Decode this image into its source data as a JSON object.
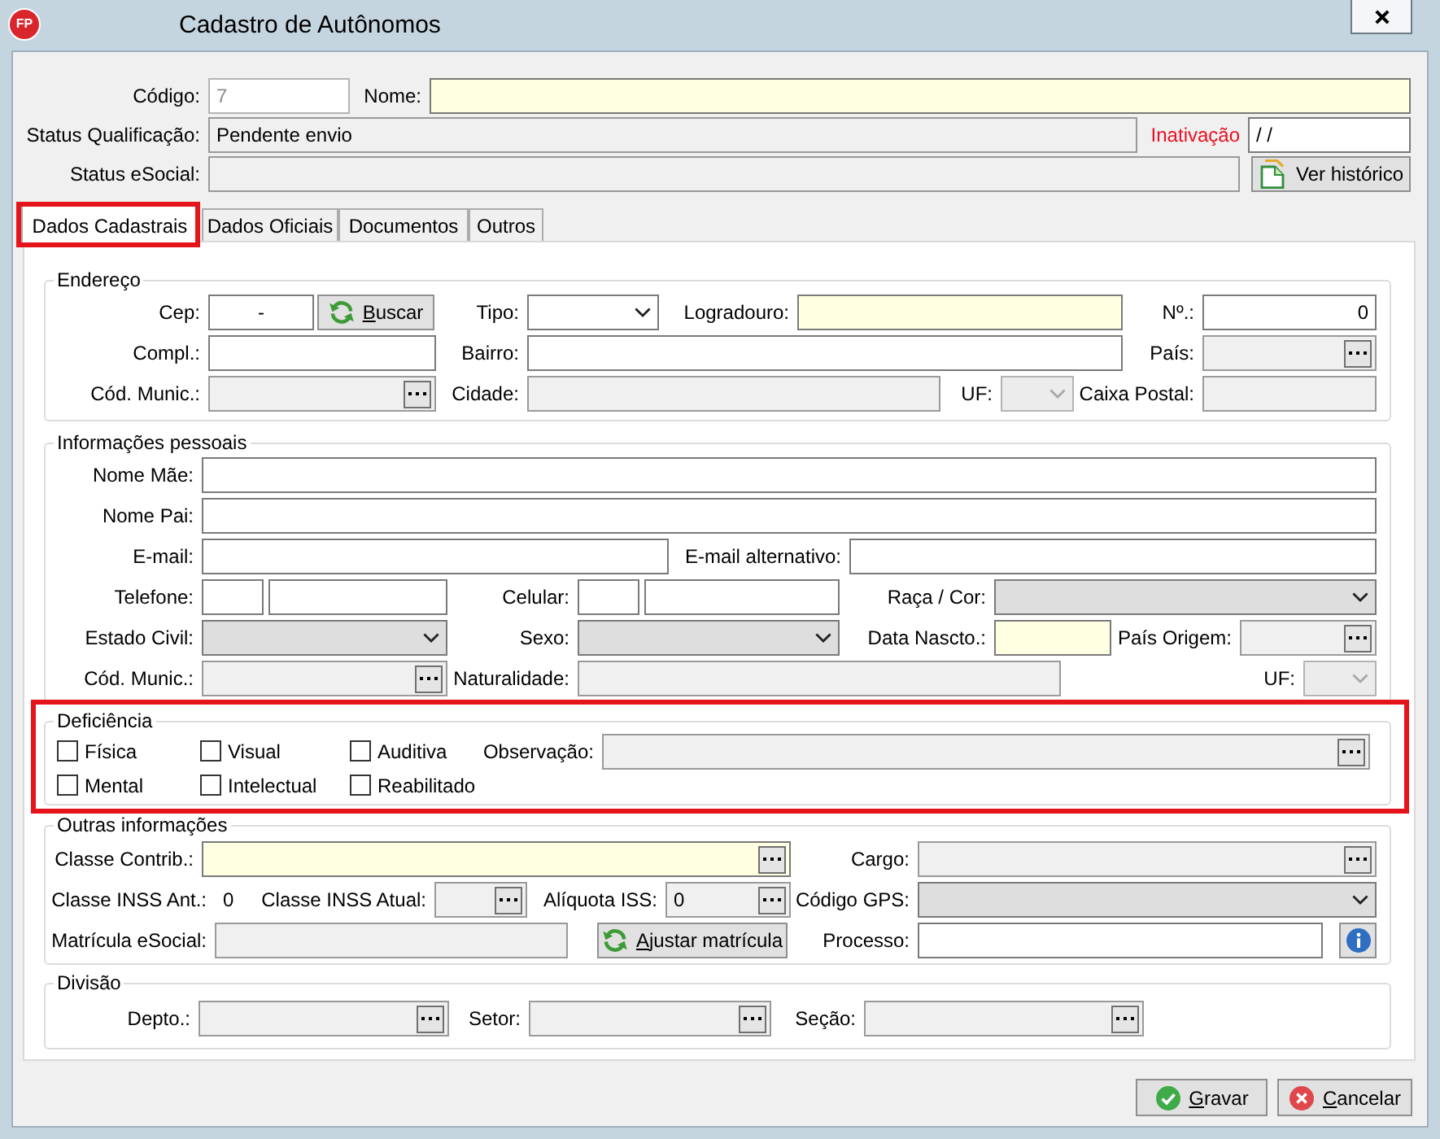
{
  "window": {
    "logo": "FP",
    "title": "Cadastro de Autônomos"
  },
  "header": [
    {
      "fields": [
        {
          "label": "Código:",
          "kind": "text",
          "value": "7",
          "required": false,
          "readonly": false,
          "disabled": true
        },
        {
          "label": "Nome:",
          "kind": "text",
          "required": true,
          "readonly": false,
          "disabled": false
        }
      ]
    },
    {
      "fields": [
        {
          "label": "Status Qualificação:",
          "kind": "text",
          "value": "Pendente envio",
          "required": false,
          "readonly": true,
          "disabled": false
        },
        {
          "label": "Inativação",
          "color": "#e81123",
          "kind": "text",
          "value": "/ /",
          "required": false,
          "readonly": false,
          "disabled": false
        }
      ]
    },
    {
      "fields": [
        {
          "label": "Status eSocial:",
          "kind": "text",
          "required": false,
          "readonly": true,
          "disabled": false
        },
        {
          "kind": "history_button",
          "text": "Ver histórico",
          "mnemonic": false
        }
      ]
    }
  ],
  "tabs": [
    {
      "label": "Dados Cadastrais",
      "selected": true,
      "highlighted": true
    },
    {
      "label": "Dados Oficiais",
      "selected": false,
      "highlighted": false
    },
    {
      "label": "Documentos",
      "selected": false,
      "highlighted": false
    },
    {
      "label": "Outros",
      "selected": false,
      "highlighted": false
    }
  ],
  "groups": [
    {
      "legend": "Endereço",
      "highlighted": false,
      "rows": [
        {
          "fields": [
            {
              "label": "Cep:",
              "kind": "masked",
              "value": "-",
              "required": false,
              "readonly": false,
              "disabled": false
            },
            {
              "kind": "refresh_button",
              "text": "Buscar",
              "mnemonic": true
            },
            {
              "label": "Tipo:",
              "kind": "select",
              "required": false,
              "readonly": false,
              "disabled": false
            },
            {
              "label": "Logradouro:",
              "kind": "text",
              "required": true,
              "readonly": false,
              "disabled": false
            },
            {
              "label": "Nº.:",
              "kind": "number",
              "value": "0",
              "required": false,
              "readonly": false,
              "disabled": false
            }
          ]
        },
        {
          "fields": [
            {
              "label": "Compl.:",
              "kind": "text",
              "required": false,
              "readonly": false,
              "disabled": false
            },
            {
              "label": "Bairro:",
              "kind": "text",
              "required": false,
              "readonly": false,
              "disabled": false
            },
            {
              "label": "País:",
              "kind": "lookup",
              "required": false,
              "readonly": true,
              "disabled": false
            }
          ]
        },
        {
          "fields": [
            {
              "label": "Cód. Munic.:",
              "kind": "lookup",
              "required": false,
              "readonly": true,
              "disabled": false
            },
            {
              "label": "Cidade:",
              "kind": "text",
              "required": false,
              "readonly": true,
              "disabled": false
            },
            {
              "label": "UF:",
              "kind": "select",
              "required": false,
              "readonly": true,
              "disabled": true
            },
            {
              "label": "Caixa Postal:",
              "kind": "text",
              "required": false,
              "readonly": true,
              "disabled": false
            }
          ]
        }
      ]
    },
    {
      "legend": "Informações pessoais",
      "highlighted": false,
      "rows": [
        {
          "fields": [
            {
              "label": "Nome Mãe:",
              "kind": "text",
              "required": false,
              "readonly": false,
              "disabled": false
            }
          ]
        },
        {
          "fields": [
            {
              "label": "Nome Pai:",
              "kind": "text",
              "required": false,
              "readonly": false,
              "disabled": false
            }
          ]
        },
        {
          "fields": [
            {
              "label": "E-mail:",
              "kind": "text",
              "required": false,
              "readonly": false,
              "disabled": false
            },
            {
              "label": "E-mail alternativo:",
              "kind": "text",
              "required": false,
              "readonly": false,
              "disabled": false
            }
          ]
        },
        {
          "fields": [
            {
              "label": "Telefone:",
              "kind": "text",
              "required": false,
              "readonly": false,
              "disabled": false
            },
            {
              "kind": "text",
              "required": false,
              "readonly": false,
              "disabled": false
            },
            {
              "label": "Celular:",
              "kind": "text",
              "required": false,
              "readonly": false,
              "disabled": false
            },
            {
              "kind": "text",
              "required": false,
              "readonly": false,
              "disabled": false
            },
            {
              "label": "Raça / Cor:",
              "kind": "select",
              "required": false,
              "readonly": true,
              "disabled": false
            }
          ]
        },
        {
          "fields": [
            {
              "label": "Estado Civil:",
              "kind": "select",
              "required": false,
              "readonly": true,
              "disabled": false
            },
            {
              "label": "Sexo:",
              "kind": "select",
              "required": false,
              "readonly": true,
              "disabled": false
            },
            {
              "label": "Data Nascto.:",
              "kind": "text",
              "required": true,
              "readonly": false,
              "disabled": false
            },
            {
              "label": "País Origem:",
              "kind": "lookup",
              "required": false,
              "readonly": true,
              "disabled": false
            }
          ]
        },
        {
          "fields": [
            {
              "label": "Cód. Munic.:",
              "kind": "lookup",
              "required": false,
              "readonly": true,
              "disabled": false
            },
            {
              "label": "Naturalidade:",
              "kind": "text",
              "required": false,
              "readonly": true,
              "disabled": false
            },
            {
              "label": "UF:",
              "kind": "select",
              "required": false,
              "readonly": true,
              "disabled": true
            }
          ]
        }
      ]
    },
    {
      "legend": "Deficiência",
      "highlighted": true,
      "checkboxes": [
        {
          "label": "Física",
          "checked": false
        },
        {
          "label": "Visual",
          "checked": false
        },
        {
          "label": "Auditiva",
          "checked": false
        },
        {
          "label": "Mental",
          "checked": false
        },
        {
          "label": "Intelectual",
          "checked": false
        },
        {
          "label": "Reabilitado",
          "checked": false
        }
      ],
      "rows": [
        {
          "fields": [
            {
              "label": "Observação:",
              "kind": "lookup",
              "required": false,
              "readonly": true,
              "disabled": false
            }
          ]
        }
      ]
    },
    {
      "legend": "Outras informações",
      "highlighted": false,
      "rows": [
        {
          "fields": [
            {
              "label": "Classe Contrib.:",
              "kind": "lookup",
              "required": true,
              "readonly": false,
              "disabled": false
            },
            {
              "label": "Cargo:",
              "kind": "lookup",
              "required": false,
              "readonly": true,
              "disabled": false
            }
          ]
        },
        {
          "fields": [
            {
              "label": "Classe INSS Ant.:",
              "kind": "static",
              "value": "0"
            },
            {
              "label": "Classe INSS Atual:",
              "kind": "lookup",
              "required": false,
              "readonly": true,
              "disabled": false
            },
            {
              "label": "Alíquota ISS:",
              "kind": "lookup",
              "value": "0",
              "required": false,
              "readonly": true,
              "disabled": false
            },
            {
              "label": "Código GPS:",
              "kind": "select",
              "required": false,
              "readonly": true,
              "disabled": false
            }
          ]
        },
        {
          "fields": [
            {
              "label": "Matrícula eSocial:",
              "kind": "text",
              "required": false,
              "readonly": true,
              "disabled": false
            },
            {
              "kind": "refresh_button",
              "text": "Ajustar matrícula",
              "mnemonic": true
            },
            {
              "label": "Processo:",
              "kind": "text",
              "required": false,
              "readonly": false,
              "disabled": false
            },
            {
              "kind": "info_button"
            }
          ]
        }
      ]
    },
    {
      "legend": "Divisão",
      "highlighted": false,
      "rows": [
        {
          "fields": [
            {
              "label": "Depto.:",
              "kind": "lookup",
              "required": false,
              "readonly": true,
              "disabled": false
            },
            {
              "label": "Setor:",
              "kind": "lookup",
              "required": false,
              "readonly": true,
              "disabled": false
            },
            {
              "label": "Seção:",
              "kind": "lookup",
              "required": false,
              "readonly": true,
              "disabled": false
            }
          ]
        }
      ]
    }
  ],
  "footer_buttons": [
    {
      "kind": "confirm_button",
      "text": "Gravar",
      "mnemonic": true
    },
    {
      "kind": "cancel_button",
      "text": "Cancelar",
      "mnemonic": true
    }
  ]
}
